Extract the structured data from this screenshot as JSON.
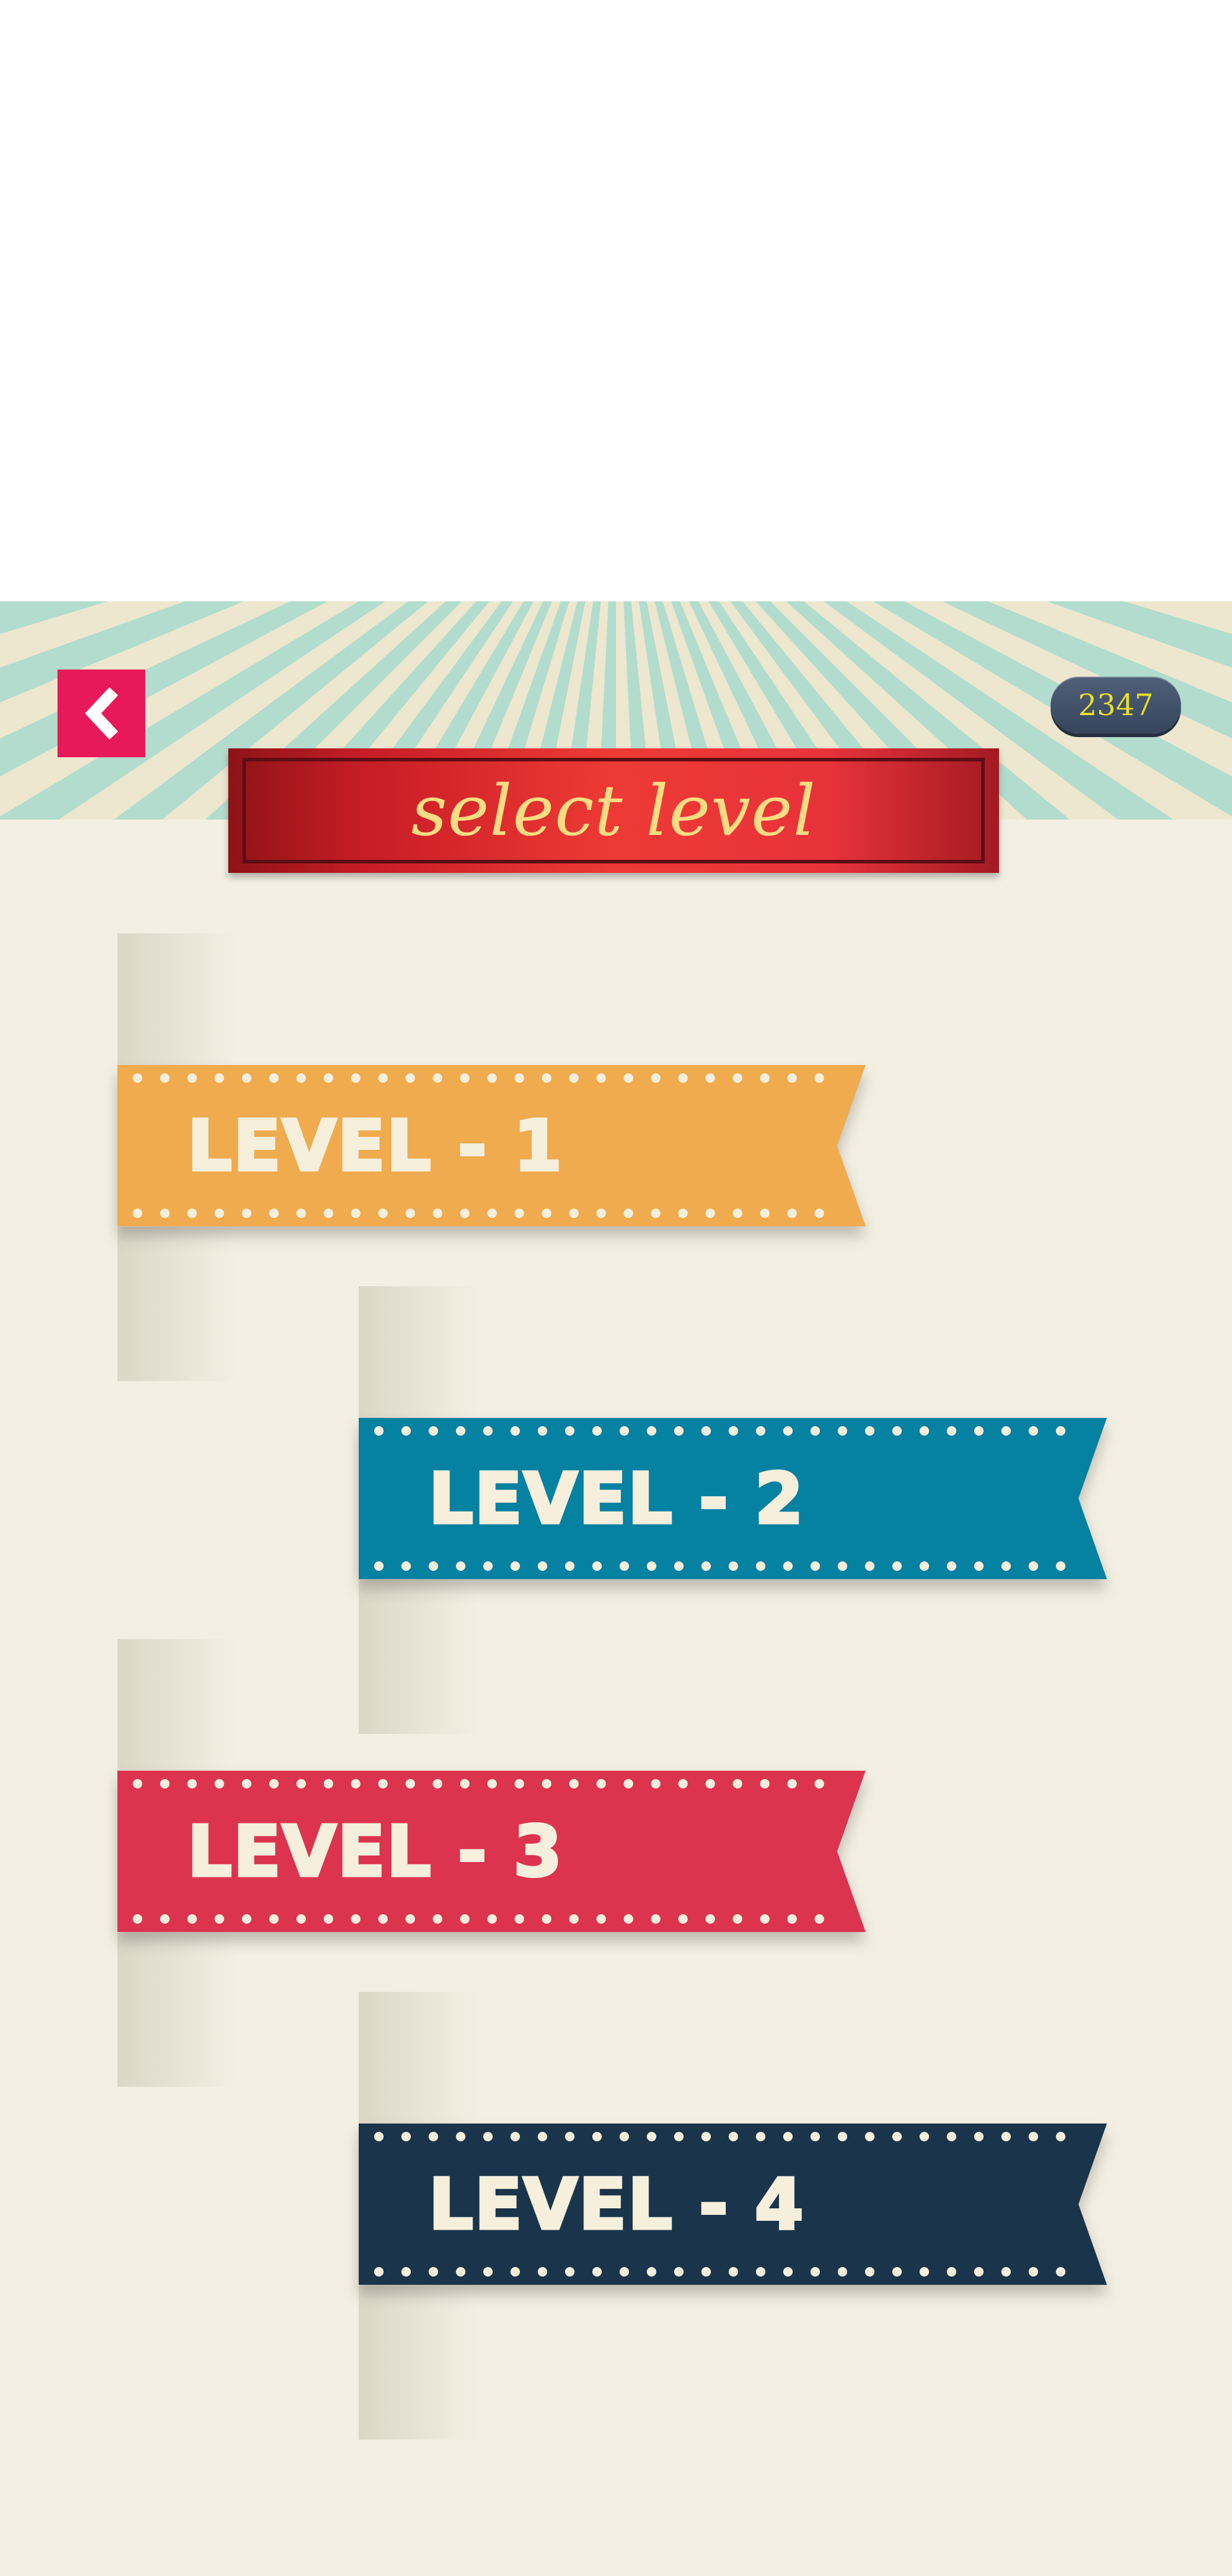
{
  "header": {
    "score": "2347",
    "title": "select level",
    "back_icon": "chevron-left-icon"
  },
  "colors": {
    "background": "#f3efe2",
    "sunburst_light": "#ede7cf",
    "sunburst_ray": "#b2dccd",
    "back_button": "#e8195a",
    "score_badge": "#3f4d63",
    "score_text": "#e9dd2b",
    "title_banner": "#d8242c",
    "title_text": "#f8dc83",
    "label_text": "#f5efdc"
  },
  "levels": [
    {
      "label": "LEVEL - 1",
      "color": "#efab4e"
    },
    {
      "label": "LEVEL - 2",
      "color": "#0581a2"
    },
    {
      "label": "LEVEL - 3",
      "color": "#dc334e"
    },
    {
      "label": "LEVEL - 4",
      "color": "#1a354b"
    }
  ]
}
